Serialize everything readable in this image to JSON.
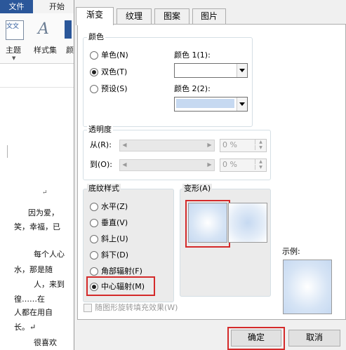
{
  "word": {
    "tabs": {
      "file": "文件",
      "home": "开始"
    },
    "ribbon": {
      "theme_label": "主题",
      "style_set_label": "样式集",
      "glyph_theme": "文文",
      "glyph_style": "A",
      "cut_label": "颜"
    },
    "doc_lines": [
      "↵",
      "因为爱，",
      "笑，幸福，已",
      "每个人心",
      "水，那是随",
      "人，来到",
      "徨……在",
      "人都在用自",
      "长。↵",
      "很喜欢"
    ]
  },
  "dialog": {
    "tabs": [
      "渐变",
      "纹理",
      "图案",
      "图片"
    ],
    "active_tab": "渐变",
    "colors": {
      "title": "颜色",
      "options": [
        {
          "label": "单色(N)",
          "selected": false
        },
        {
          "label": "双色(T)",
          "selected": true
        },
        {
          "label": "预设(S)",
          "selected": false
        }
      ],
      "color1_label": "颜色 1(1):",
      "color1_value": "#ffffff",
      "color2_label": "颜色 2(2):",
      "color2_value": "#c6d9f1"
    },
    "transparency": {
      "title": "透明度",
      "from_label": "从(R):",
      "to_label": "到(O):",
      "from_value": "0 %",
      "to_value": "0 %"
    },
    "shading": {
      "title": "底纹样式",
      "options": [
        {
          "label": "水平(Z)",
          "selected": false
        },
        {
          "label": "垂直(V)",
          "selected": false
        },
        {
          "label": "斜上(U)",
          "selected": false
        },
        {
          "label": "斜下(D)",
          "selected": false
        },
        {
          "label": "角部辐射(F)",
          "selected": false
        },
        {
          "label": "中心辐射(M)",
          "selected": true
        }
      ]
    },
    "variants_title": "变形(A)",
    "sample_label": "示例:",
    "rotate_checkbox_label": "随图形旋转填充效果(W)",
    "ok_button": "确定",
    "cancel_button": "取消",
    "highlight_color": "#d42a2a"
  }
}
